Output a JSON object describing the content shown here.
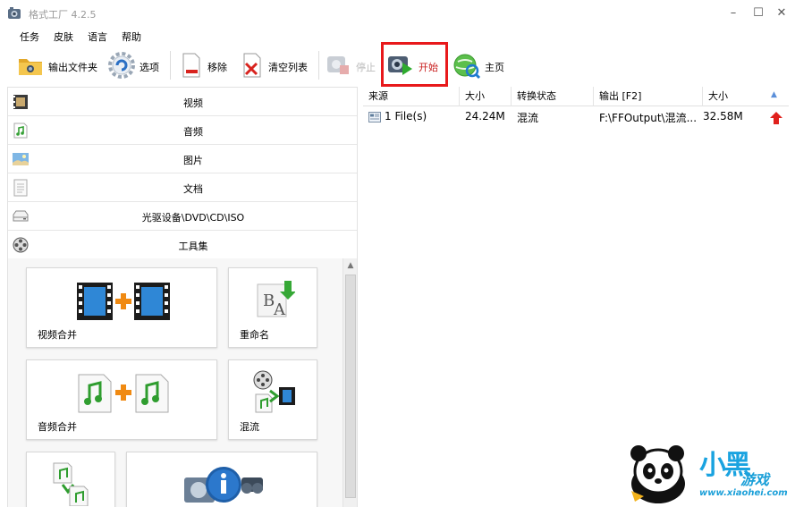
{
  "window": {
    "title": "格式工厂 4.2.5",
    "minimize": "–",
    "maximize": "☐",
    "close": "✕"
  },
  "menu": [
    "任务",
    "皮肤",
    "语言",
    "帮助"
  ],
  "toolbar": {
    "output_folder": "输出文件夹",
    "options": "选项",
    "remove": "移除",
    "clear_list": "清空列表",
    "stop": "停止",
    "start": "开始",
    "home": "主页"
  },
  "categories": [
    "视频",
    "音频",
    "图片",
    "文档",
    "光驱设备\\DVD\\CD\\ISO",
    "工具集"
  ],
  "tools": [
    "视频合并",
    "重命名",
    "音频合并",
    "混流"
  ],
  "list": {
    "columns": [
      "来源",
      "大小",
      "转换状态",
      "输出 [F2]",
      "大小"
    ],
    "rows": [
      {
        "source": "1 File(s)",
        "size": "24.24M",
        "status": "混流",
        "output": "F:\\FFOutput\\混流...",
        "out_size": "32.58M"
      }
    ]
  },
  "watermark": {
    "brand": "小黑",
    "sub": "游戏",
    "site": "www.xiaohei.com"
  },
  "colors": {
    "highlight": "#e8191b",
    "accent": "#1aa3e0"
  }
}
